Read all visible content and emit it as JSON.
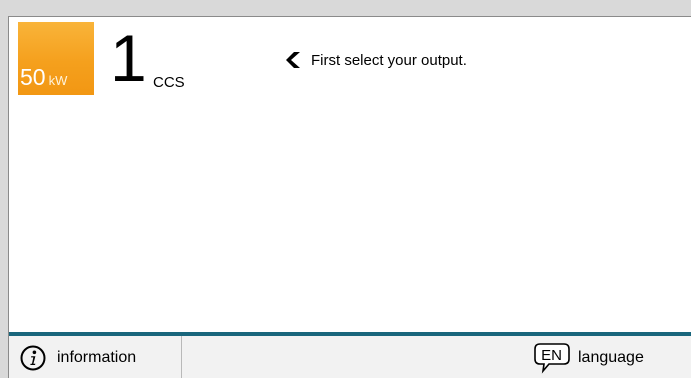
{
  "output": {
    "power_value": "50",
    "power_unit": "kW",
    "connector_number": "1",
    "connector_type": "CCS"
  },
  "hint": {
    "icon": "chevron-left-icon",
    "text": "First select your output."
  },
  "footer": {
    "information_label": "information",
    "language_code": "EN",
    "language_label": "language",
    "information_icon": "info-icon",
    "language_icon": "speech-bubble-icon"
  },
  "colors": {
    "power_tile": "#f5a01d",
    "footer_accent": "#19667c",
    "background": "#ffffff"
  }
}
